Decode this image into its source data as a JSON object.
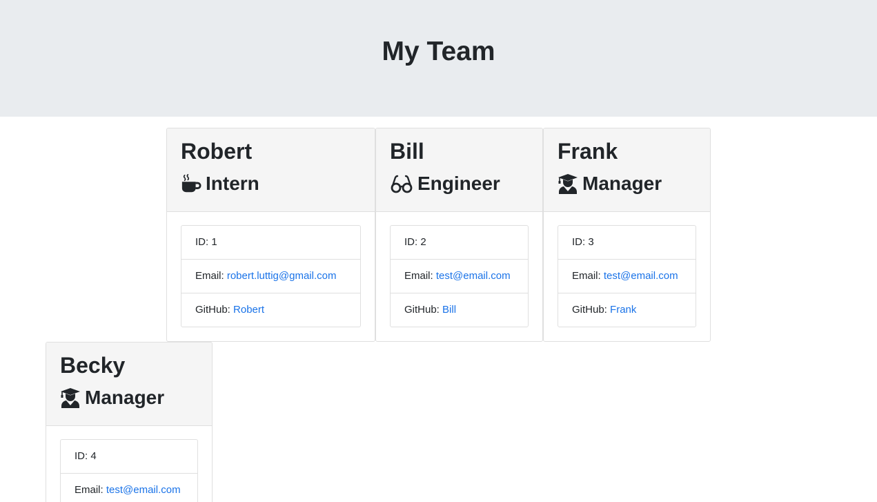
{
  "header": {
    "title": "My Team"
  },
  "cards": [
    {
      "name": "Robert",
      "role": "Intern",
      "icon": "coffee-mug-icon",
      "id_label": "ID: ",
      "id": "1",
      "email_label": "Email: ",
      "email": "robert.luttig@gmail.com",
      "github_label": "GitHub: ",
      "github": "Robert"
    },
    {
      "name": "Bill",
      "role": "Engineer",
      "icon": "glasses-icon",
      "id_label": "ID: ",
      "id": "2",
      "email_label": "Email: ",
      "email": "test@email.com",
      "github_label": "GitHub: ",
      "github": "Bill"
    },
    {
      "name": "Frank",
      "role": "Manager",
      "icon": "graduate-icon",
      "id_label": "ID: ",
      "id": "3",
      "email_label": "Email: ",
      "email": "test@email.com",
      "github_label": "GitHub: ",
      "github": "Frank"
    },
    {
      "name": "Becky",
      "role": "Manager",
      "icon": "graduate-icon",
      "id_label": "ID: ",
      "id": "4",
      "email_label": "Email: ",
      "email": "test@email.com"
    }
  ],
  "colors": {
    "header_bg": "#e9ecef",
    "card_header_bg": "#f5f5f5",
    "link": "#1a73e8",
    "text": "#212529"
  }
}
